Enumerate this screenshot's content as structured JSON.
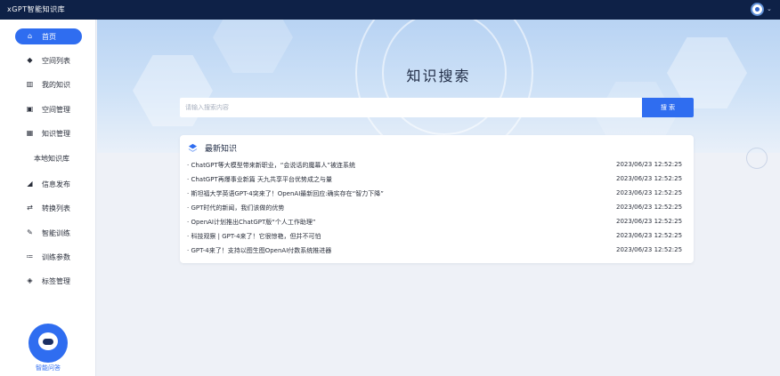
{
  "app": {
    "title": "xGPT智能知识库"
  },
  "sidebar": {
    "items": [
      {
        "label": "首页",
        "icon": "home-icon",
        "glyph": "⌂"
      },
      {
        "label": "空间列表",
        "icon": "space-icon",
        "glyph": "◆"
      },
      {
        "label": "我的知识",
        "icon": "books-icon",
        "glyph": "▥"
      },
      {
        "label": "空间管理",
        "icon": "manage-icon",
        "glyph": "▣"
      },
      {
        "label": "知识管理",
        "icon": "grid-icon",
        "glyph": "▦"
      },
      {
        "label": "本地知识库"
      },
      {
        "label": "信息发布",
        "icon": "send-icon",
        "glyph": "◢"
      },
      {
        "label": "转换列表",
        "icon": "swap-icon",
        "glyph": "⇄"
      },
      {
        "label": "智能训练",
        "icon": "train-icon",
        "glyph": "✎"
      },
      {
        "label": "训练参数",
        "icon": "params-icon",
        "glyph": "≔"
      },
      {
        "label": "标签管理",
        "icon": "tag-icon",
        "glyph": "◈"
      }
    ],
    "assistant_label": "智能问答"
  },
  "main": {
    "banner_title": "知识搜索",
    "search": {
      "placeholder": "请输入搜索内容",
      "button": "搜 索"
    },
    "news": {
      "title": "最新知识",
      "items": [
        {
          "text": "· ChatGPT等大模型带来新职业，“会说话的魔幕人”被连系统",
          "date": "2023/06/23",
          "time": "12:52:25"
        },
        {
          "text": "· ChatGPT再爆事业新篇 天九共享平台优势成之与量",
          "date": "2023/06/23",
          "time": "12:52:25"
        },
        {
          "text": "· 斯坦福大学英语GPT-4突来了！OpenAI最新回应:确实存在“智力下降”",
          "date": "2023/06/23",
          "time": "12:52:25"
        },
        {
          "text": "· GPT时代的新闻，我们该做的优势",
          "date": "2023/06/23",
          "time": "12:52:25"
        },
        {
          "text": "· OpenAI计划推出ChatGPT版“个人工作助理”",
          "date": "2023/06/23",
          "time": "12:52:25"
        },
        {
          "text": "· 科技观察 | GPT-4来了！它很惊艳，但并不可怕",
          "date": "2023/06/23",
          "time": "12:52:25"
        },
        {
          "text": "· GPT-4来了！支持以图生图OpenAI付数系统推进器",
          "date": "2023/06/23",
          "time": "12:52:25"
        }
      ]
    }
  },
  "colors": {
    "accent": "#2f6df0",
    "topbar": "#0e2147"
  }
}
